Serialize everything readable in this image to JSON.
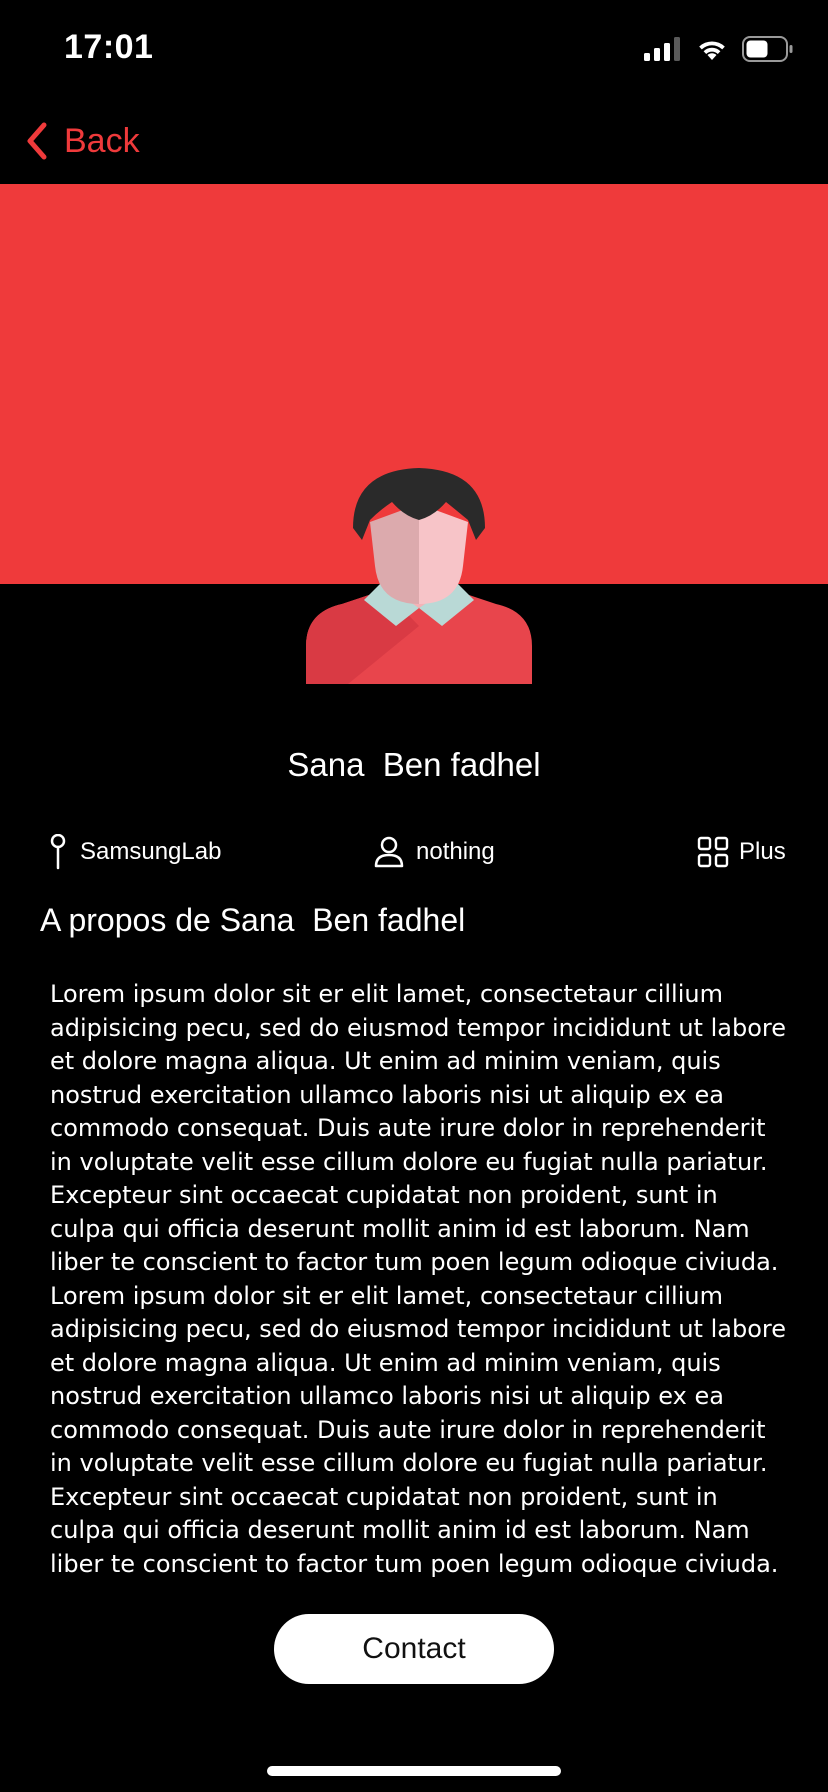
{
  "status_bar": {
    "time": "17:01",
    "icons": [
      "cellular-signal-icon",
      "wifi-icon",
      "battery-icon"
    ]
  },
  "nav": {
    "back_label": "Back",
    "back_icon": "chevron-left-icon"
  },
  "colors": {
    "accent": "#ef3a3b",
    "background": "#000000",
    "text": "#ffffff",
    "button_bg": "#ffffff",
    "button_text": "#111111"
  },
  "profile": {
    "name": "Sana  Ben fadhel",
    "avatar_icon": "user-avatar-illustration"
  },
  "info": {
    "company": "SamsungLab",
    "company_icon": "location-pin-icon",
    "role": "nothing",
    "role_icon": "person-icon",
    "more": "Plus",
    "more_icon": "grid-icon"
  },
  "about": {
    "title": "A propos de Sana  Ben fadhel",
    "text": "Lorem ipsum dolor sit er elit lamet, consectetaur cillium adipisicing pecu, sed do eiusmod tempor incididunt ut labore et dolore magna aliqua. Ut enim ad minim veniam, quis nostrud exercitation ullamco laboris nisi ut aliquip ex ea commodo consequat. Duis aute irure dolor in reprehenderit in voluptate velit esse cillum dolore eu fugiat nulla pariatur. Excepteur sint occaecat cupidatat non proident, sunt in culpa qui officia deserunt mollit anim id est laborum. Nam liber te conscient to factor tum poen legum odioque civiuda. Lorem ipsum dolor sit er elit lamet, consectetaur cillium adipisicing pecu, sed do eiusmod tempor incididunt ut labore et dolore magna aliqua. Ut enim ad minim veniam, quis nostrud exercitation ullamco laboris nisi ut aliquip ex ea commodo consequat. Duis aute irure dolor in reprehenderit in voluptate velit esse cillum dolore eu fugiat nulla pariatur. Excepteur sint occaecat cupidatat non proident, sunt in culpa qui officia deserunt mollit anim id est laborum. Nam liber te conscient to factor tum poen legum odioque civiuda."
  },
  "actions": {
    "contact_label": "Contact"
  }
}
